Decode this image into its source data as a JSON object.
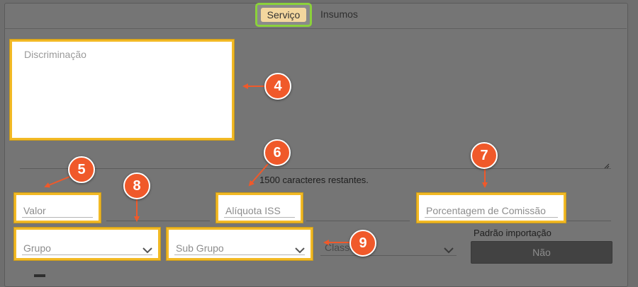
{
  "tabs": {
    "active": "Serviço",
    "inactive": "Insumos"
  },
  "discriminacao": {
    "placeholder": "Discriminação"
  },
  "counter_text": "1500 caracteres restantes.",
  "fields": {
    "valor": "Valor",
    "aliquota_iss": "Alíquota ISS",
    "porcentagem_comissao": "Porcentagem de Comissão",
    "grupo": "Grupo",
    "sub_grupo": "Sub Grupo",
    "classe": "Classe"
  },
  "padrao_importacao": {
    "label": "Padrão importação",
    "button": "Não"
  },
  "badges": [
    "4",
    "5",
    "6",
    "7",
    "8",
    "9"
  ],
  "colors": {
    "highlight": "#f2b925",
    "active_tab_border": "#8bd13b",
    "badge": "#f0592a",
    "active_tab_bg": "#f3d79e"
  },
  "icons": [
    "chevron-down-icon",
    "resize-grip-icon",
    "arrow-icon"
  ]
}
